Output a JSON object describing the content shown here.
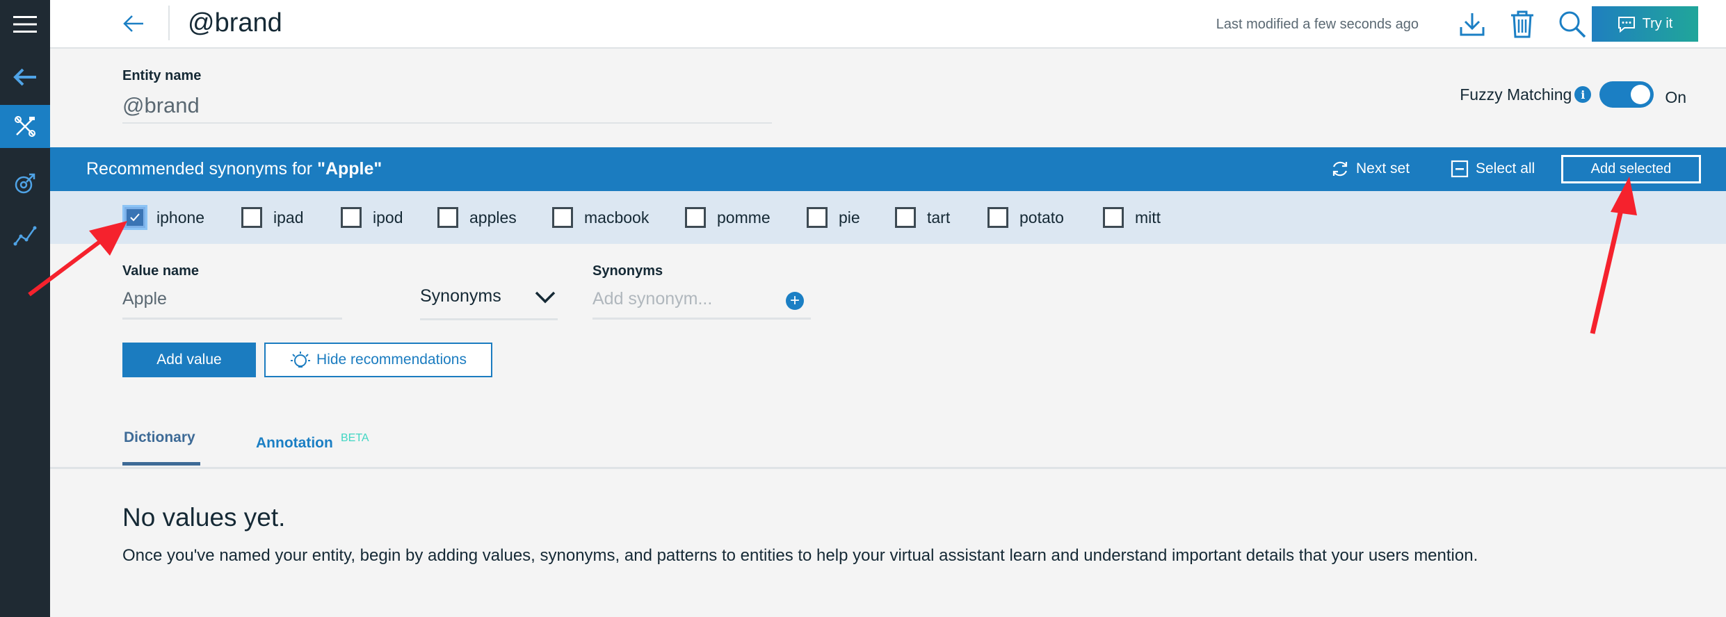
{
  "header": {
    "title": "@brand",
    "modified": "Last modified a few seconds ago",
    "try_label": "Try it"
  },
  "entity": {
    "label": "Entity name",
    "value": "@brand",
    "fuzzy_label": "Fuzzy Matching",
    "fuzzy_state": "On"
  },
  "recommend": {
    "title_prefix": "Recommended synonyms for ",
    "title_value": "\"Apple\"",
    "next_set": "Next set",
    "select_all": "Select all",
    "add_selected": "Add selected",
    "items": [
      {
        "label": "iphone",
        "checked": true
      },
      {
        "label": "ipad",
        "checked": false
      },
      {
        "label": "ipod",
        "checked": false
      },
      {
        "label": "apples",
        "checked": false
      },
      {
        "label": "macbook",
        "checked": false
      },
      {
        "label": "pomme",
        "checked": false
      },
      {
        "label": "pie",
        "checked": false
      },
      {
        "label": "tart",
        "checked": false
      },
      {
        "label": "potato",
        "checked": false
      },
      {
        "label": "mitt",
        "checked": false
      }
    ]
  },
  "value_form": {
    "value_label": "Value name",
    "value": "Apple",
    "type": "Synonyms",
    "synonyms_label": "Synonyms",
    "synonyms_placeholder": "Add synonym...",
    "add_value": "Add value",
    "hide_recommendations": "Hide recommendations"
  },
  "tabs": {
    "dictionary": "Dictionary",
    "annotation": "Annotation",
    "annotation_badge": "BETA"
  },
  "empty": {
    "title": "No values yet.",
    "description": "Once you've named your entity, begin by adding values, synonyms, and patterns to entities to help your virtual assistant learn and understand important details that your users mention."
  },
  "colors": {
    "primary": "#1b7cc0",
    "rail": "#1f2a33",
    "synonym_row": "#dce7f2",
    "annotation_arrow": "#f5222d"
  },
  "icons": {
    "menu": "menu-icon",
    "back": "arrow-left-icon",
    "tools": "tools-icon",
    "intents": "target-icon",
    "analytics": "analytics-icon",
    "download": "download-icon",
    "delete": "trash-icon",
    "search": "search-icon",
    "chat": "chat-icon",
    "refresh": "refresh-icon",
    "select_all": "select-all-icon",
    "info": "info-icon",
    "add": "add-circle-icon",
    "bulb": "lightbulb-icon",
    "chevron": "chevron-down-icon"
  }
}
